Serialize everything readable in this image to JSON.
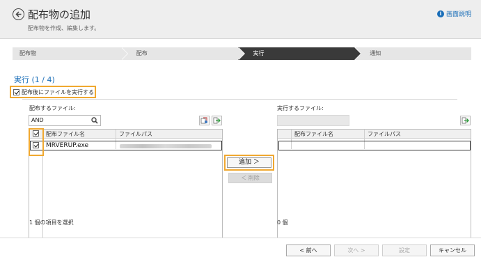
{
  "header": {
    "title": "配布物の追加",
    "subtitle": "配布物を作成、編集します。",
    "help_label": "画面説明"
  },
  "steps": [
    {
      "label": "配布物",
      "active": false
    },
    {
      "label": "配布",
      "active": false
    },
    {
      "label": "実行",
      "active": true
    },
    {
      "label": "通知",
      "active": false
    }
  ],
  "progress_label": "実行 (1 / 4)",
  "exec_after_distribution": {
    "label": "配布後にファイルを実行する",
    "checked": true
  },
  "source": {
    "label": "配布するファイル:",
    "search_value": "AND",
    "columns": [
      "配布ファイル名",
      "ファイルパス"
    ],
    "rows": [
      {
        "name": "MRVERUP.exe",
        "checked": true
      }
    ],
    "selection_count": "1 個の項目を選択"
  },
  "destination": {
    "label": "実行するファイル:",
    "columns": [
      "配布ファイル名",
      "ファイルパス"
    ],
    "count": "0 個"
  },
  "buttons": {
    "add": "追加 ＞",
    "remove": "＜ 削除",
    "prev": "< 前へ",
    "next": "次へ >",
    "settings": "設定",
    "cancel": "キャンセル"
  },
  "colors": {
    "accent": "#1a6eb8",
    "highlight": "#f0a830",
    "active_step": "#3a3a3a"
  },
  "icons": [
    "back-arrow-icon",
    "info-icon",
    "search-icon",
    "export-icon",
    "import-icon"
  ]
}
